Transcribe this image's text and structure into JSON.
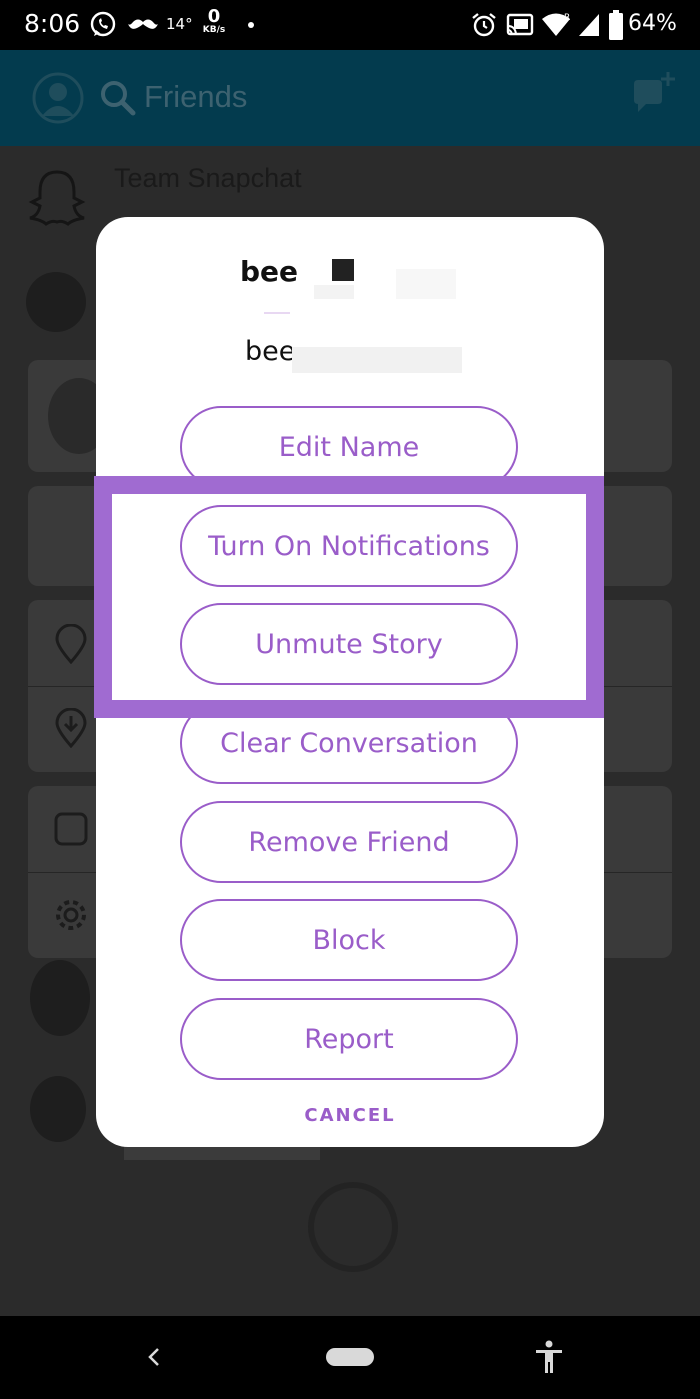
{
  "status_bar": {
    "time": "8:06",
    "temperature": "14°",
    "net_speed_value": "0",
    "net_speed_unit": "KB/s",
    "battery_percent": "64%",
    "icons": [
      "whatsapp-icon",
      "mustache-icon",
      "alarm-icon",
      "cast-icon",
      "wifi-icon",
      "signal-icon",
      "battery-icon"
    ]
  },
  "header": {
    "title": "Friends"
  },
  "background_list": {
    "first_row_title": "Team Snapchat"
  },
  "dialog": {
    "username": "bee",
    "display_name": "bee",
    "actions": [
      {
        "label": "Edit Name"
      },
      {
        "label": "Turn On Notifications"
      },
      {
        "label": "Unmute Story"
      },
      {
        "label": "Clear Conversation"
      },
      {
        "label": "Remove Friend"
      },
      {
        "label": "Block"
      },
      {
        "label": "Report"
      }
    ],
    "cancel_label": "CANCEL"
  },
  "colors": {
    "accent": "#9a5dc9",
    "highlight": "#a06bd1",
    "header_bg": "#033b4e"
  }
}
